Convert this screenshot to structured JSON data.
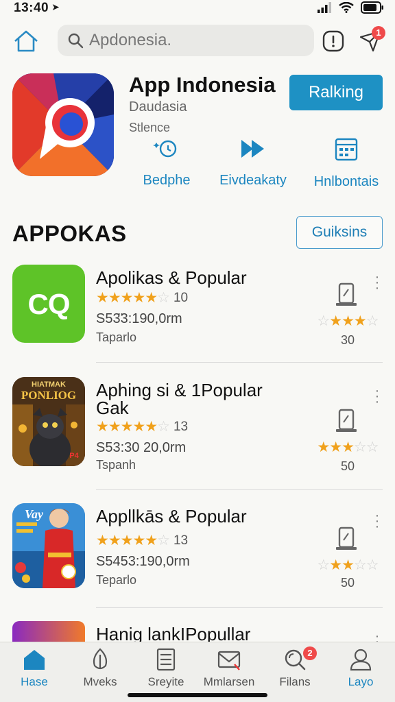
{
  "status_bar": {
    "time": "13:40"
  },
  "search": {
    "placeholder": "Apdonesia."
  },
  "notifications": {
    "badge": "1"
  },
  "featured": {
    "title": "App Indonesia",
    "developer": "Daudasia",
    "category": "Stlence",
    "primary_button": "Ralking",
    "actions": [
      {
        "label": "Bedphe",
        "icon": "sparkle-icon"
      },
      {
        "label": "Eivdeakaty",
        "icon": "fast-forward-icon"
      },
      {
        "label": "Hnlbontais",
        "icon": "calendar-icon"
      }
    ]
  },
  "section": {
    "title": "APPOKAS",
    "button": "Guiksins"
  },
  "apps": [
    {
      "name": "Apolikas & Popular",
      "rating_count": "10",
      "price": "S53̈3:190,0rm",
      "category": "Taparlo",
      "side_count": "30",
      "thumb": "CQ"
    },
    {
      "name": "Aphing si & 1Popular Gak",
      "rating_count": "13",
      "price": "S53:30 20,0rm",
      "category": "Tspanh",
      "side_count": "50",
      "thumb_title": "HIATMAK PONLIOG",
      "thumb_tag": "P4"
    },
    {
      "name": "Appllkās & Popular",
      "rating_count": "13",
      "price": "S5453:190,0rm",
      "category": "Teparlo",
      "side_count": "50",
      "thumb_title": "Vay"
    },
    {
      "name": "Hanig lankIPopullar",
      "rating_count": "",
      "price": "",
      "category": "",
      "side_count": ""
    }
  ],
  "tabs": [
    {
      "label": "Hase",
      "icon": "home-icon",
      "active": true
    },
    {
      "label": "Mveks",
      "icon": "leaf-icon"
    },
    {
      "label": "Sreyite",
      "icon": "list-icon"
    },
    {
      "label": "Mmlarsen",
      "icon": "mail-icon"
    },
    {
      "label": "Filans",
      "icon": "search-icon",
      "badge": "2"
    },
    {
      "label": "Layo",
      "icon": "person-icon"
    }
  ],
  "colors": {
    "accent": "#1e91c4",
    "star": "#f0a11c",
    "badge": "#ef4a4a"
  }
}
